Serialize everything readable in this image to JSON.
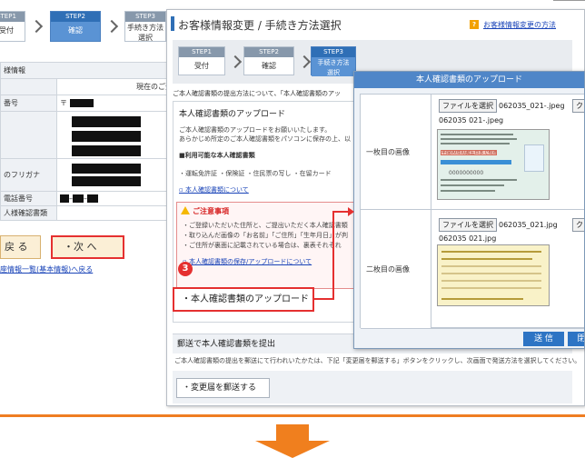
{
  "background_window": {
    "steps": [
      {
        "num": "STEP1",
        "label": "受付"
      },
      {
        "num": "STEP2",
        "label": "確認"
      },
      {
        "num": "STEP3",
        "label": "手続き方法選択"
      }
    ],
    "table": {
      "header": "様情報",
      "column_header": "現在のご登",
      "rows": [
        {
          "label": "番号",
          "value": "〒"
        },
        {
          "label": "",
          "value": ""
        },
        {
          "label": "のフリガナ",
          "value": ""
        },
        {
          "label": "電話番号",
          "value": ""
        },
        {
          "label": "人様確認書類",
          "value": ""
        }
      ]
    },
    "back_label": "戻 る",
    "next_label": "・次 へ",
    "list_link": "座情報一覧(基本情報)へ戻る"
  },
  "main_window": {
    "title": "お客様情報変更 / 手続き方法選択",
    "help_icon": "?",
    "help_link": "お客様情報変更の方法",
    "steps": [
      {
        "num": "STEP1",
        "label": "受付"
      },
      {
        "num": "STEP2",
        "label": "確認"
      },
      {
        "num": "STEP3",
        "label": "手続き方法選択"
      }
    ],
    "intro": "ご本人確認書類の提出方法について、「本人確認書類のアッ",
    "upload_section": {
      "title": "本人確認書類のアップロード",
      "desc1": "ご本人確認書類のアップロードをお願いいたします。",
      "desc2": "あらかじめ所定のご本人確認書類をパソコンに保存の上、以",
      "available_title": "■利用可能な本人確認書類",
      "available_docs": "・運転免許証 ・保険証 ・住民票の写し ・在留カード",
      "about_link": "本人確認書類について",
      "caution": {
        "title": "ご注意事項",
        "lines": [
          "・ご登録いただいた住所と、ご提出いただく本人確認書類",
          "・取り込んだ画像の「お名前」「ご住所」「生年月日」が判",
          "・ご住所が裏面に記載されている場合は、裏表それぞれ"
        ],
        "link": "本人確認書類の保存/アップロードについて"
      },
      "step_badge": "3",
      "upload_button": "・本人確認書類のアップロード"
    },
    "mail_section": {
      "title": "郵送で本人確認書類を提出",
      "desc": "ご本人確認書類の提出を郵送にて行われいたかたは、下記「変更届を郵送する」ボタンをクリックし、次画面で発送方法を選択してください。",
      "button": "・変更届を郵送する"
    }
  },
  "upload_dialog": {
    "title": "本人確認書類のアップロード",
    "rows": [
      {
        "label": "一枚目の画像",
        "file_button": "ファイルを選択",
        "selected_file": "062035_021-.jpeg",
        "preview_name": "062035 021-.jpeg",
        "clear_button": "クリ"
      },
      {
        "label": "二枚目の画像",
        "file_button": "ファイルを選択",
        "selected_file": "062035_021.jpg",
        "preview_name": "062035 021.jpg",
        "clear_button": "クリ"
      }
    ],
    "card1_banner": "平成00年の誕生日まで有効",
    "card1_number": "0000000000",
    "send_button": "送 信",
    "close_button": "閉"
  },
  "colors": {
    "accent_blue": "#2f6fb6",
    "highlight_red": "#e53030",
    "arrow_orange": "#f07f1e",
    "button_bg": "#fbefd6"
  }
}
